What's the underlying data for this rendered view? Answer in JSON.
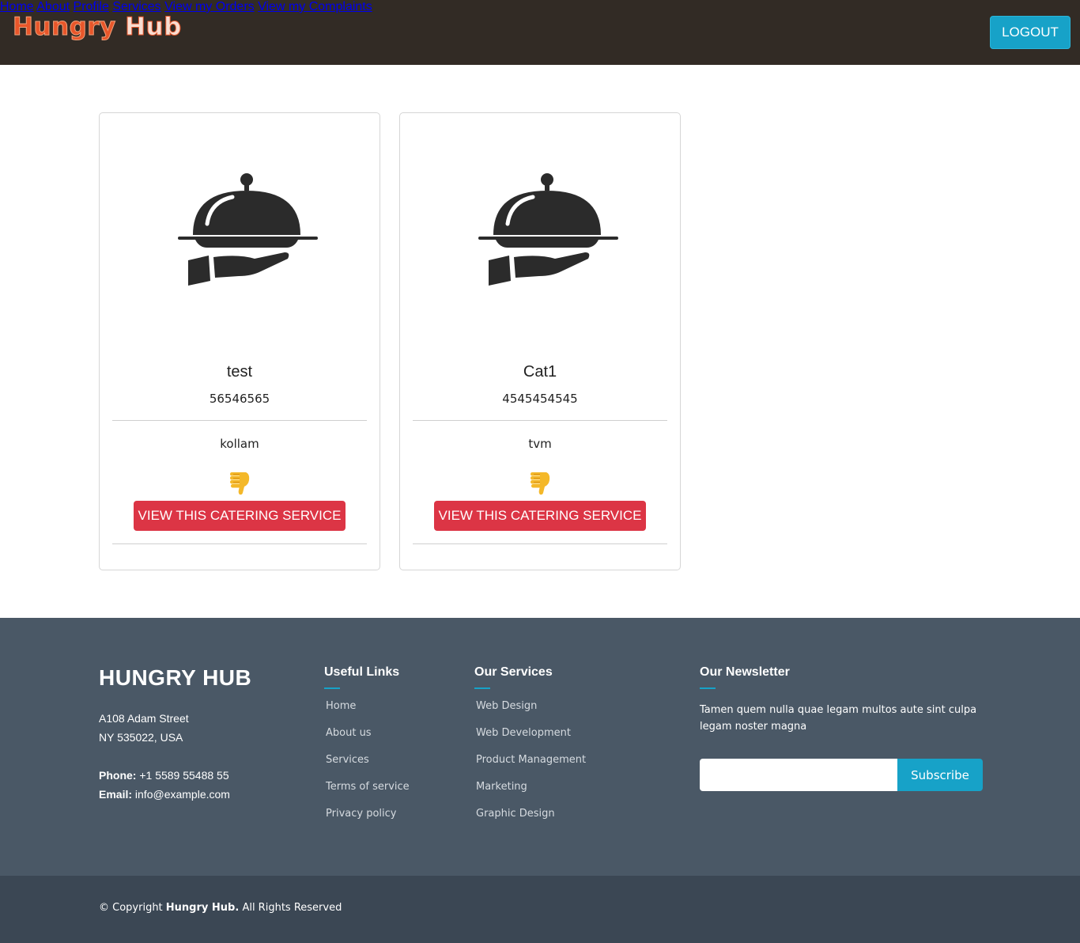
{
  "brand": {
    "word1": "Hungry",
    "word2": "Hub"
  },
  "nav": {
    "items": [
      "Home",
      "About",
      "Profile",
      "Services",
      "View my Orders",
      "View my Complaints"
    ],
    "logout_label": "LOGOUT"
  },
  "cards": [
    {
      "name": "test",
      "phone": "56546565",
      "location": "kollam",
      "button_label": "VIEW THIS CATERING SERVICE",
      "icon": "catering-cloche-icon",
      "rating_icon": "thumbs-down-icon"
    },
    {
      "name": "Cat1",
      "phone": "4545454545",
      "location": "tvm",
      "button_label": "VIEW THIS CATERING SERVICE",
      "icon": "catering-cloche-icon",
      "rating_icon": "thumbs-down-icon"
    }
  ],
  "footer": {
    "title": "HUNGRY HUB",
    "address_line1": "A108 Adam Street",
    "address_line2": "NY 535022, USA",
    "phone_label": "Phone:",
    "phone": "+1 5589 55488 55",
    "email_label": "Email:",
    "email": "info@example.com",
    "useful_links": {
      "heading": "Useful Links",
      "items": [
        "Home",
        "About us",
        "Services",
        "Terms of service",
        "Privacy policy"
      ]
    },
    "services": {
      "heading": "Our Services",
      "items": [
        "Web Design",
        "Web Development",
        "Product Management",
        "Marketing",
        "Graphic Design"
      ]
    },
    "newsletter": {
      "heading": "Our Newsletter",
      "text": "Tamen quem nulla quae legam multos aute sint culpa legam noster magna",
      "input_value": "",
      "button_label": "Subscribe"
    }
  },
  "copyright": {
    "prefix": "© Copyright",
    "brand": "Hungry Hub.",
    "suffix": "All Rights Reserved"
  },
  "colors": {
    "header_bg": "#322b25",
    "accent": "#17a2c8",
    "danger": "#dc3545",
    "footer_bg": "#4a5866",
    "copyright_bg": "#3b4754",
    "logo_orange": "#e8562a"
  }
}
